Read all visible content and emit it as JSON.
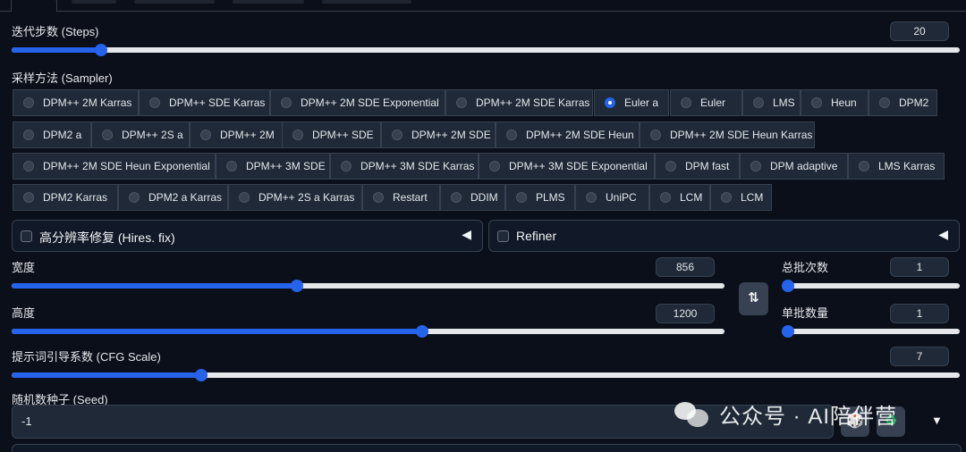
{
  "steps": {
    "label": "迭代步数 (Steps)",
    "value": "20",
    "fraction": 0.094
  },
  "sampler": {
    "label": "采样方法 (Sampler)",
    "selected": "Euler a",
    "options": [
      "DPM++ 2M Karras",
      "DPM++ SDE Karras",
      "DPM++ 2M SDE Exponential",
      "DPM++ 2M SDE Karras",
      "Euler a",
      "Euler",
      "LMS",
      "Heun",
      "DPM2",
      "DPM2 a",
      "DPM++ 2S a",
      "DPM++ 2M",
      "DPM++ SDE",
      "DPM++ 2M SDE",
      "DPM++ 2M SDE Heun",
      "DPM++ 2M SDE Heun Karras",
      "DPM++ 2M SDE Heun Exponential",
      "DPM++ 3M SDE",
      "DPM++ 3M SDE Karras",
      "DPM++ 3M SDE Exponential",
      "DPM fast",
      "DPM adaptive",
      "LMS Karras",
      "DPM2 Karras",
      "DPM2 a Karras",
      "DPM++ 2S a Karras",
      "Restart",
      "DDIM",
      "PLMS",
      "UniPC",
      "LCM",
      "LCM"
    ]
  },
  "hires": {
    "label": "高分辨率修复 (Hires. fix)",
    "caret": "◀"
  },
  "refiner": {
    "label": "Refiner",
    "caret": "◀"
  },
  "width": {
    "label": "宽度",
    "value": "856",
    "fraction": 0.4
  },
  "height": {
    "label": "高度",
    "value": "1200",
    "fraction": 0.576
  },
  "swap_button": {
    "label": "⇅"
  },
  "batch_count": {
    "label": "总批次数",
    "value": "1",
    "fraction": 0.0
  },
  "batch_size": {
    "label": "单批数量",
    "value": "1",
    "fraction": 0.0
  },
  "cfg": {
    "label": "提示词引导系数 (CFG Scale)",
    "value": "7",
    "fraction": 0.2
  },
  "seed": {
    "label": "随机数种子 (Seed)",
    "value": "-1",
    "dropdown": "▼"
  },
  "watermark": {
    "text": "公众号 · AI陪伴营"
  },
  "colors": {
    "accent": "#2563eb",
    "background": "#0b0f19",
    "panel": "#1f2937",
    "border": "#374151"
  }
}
